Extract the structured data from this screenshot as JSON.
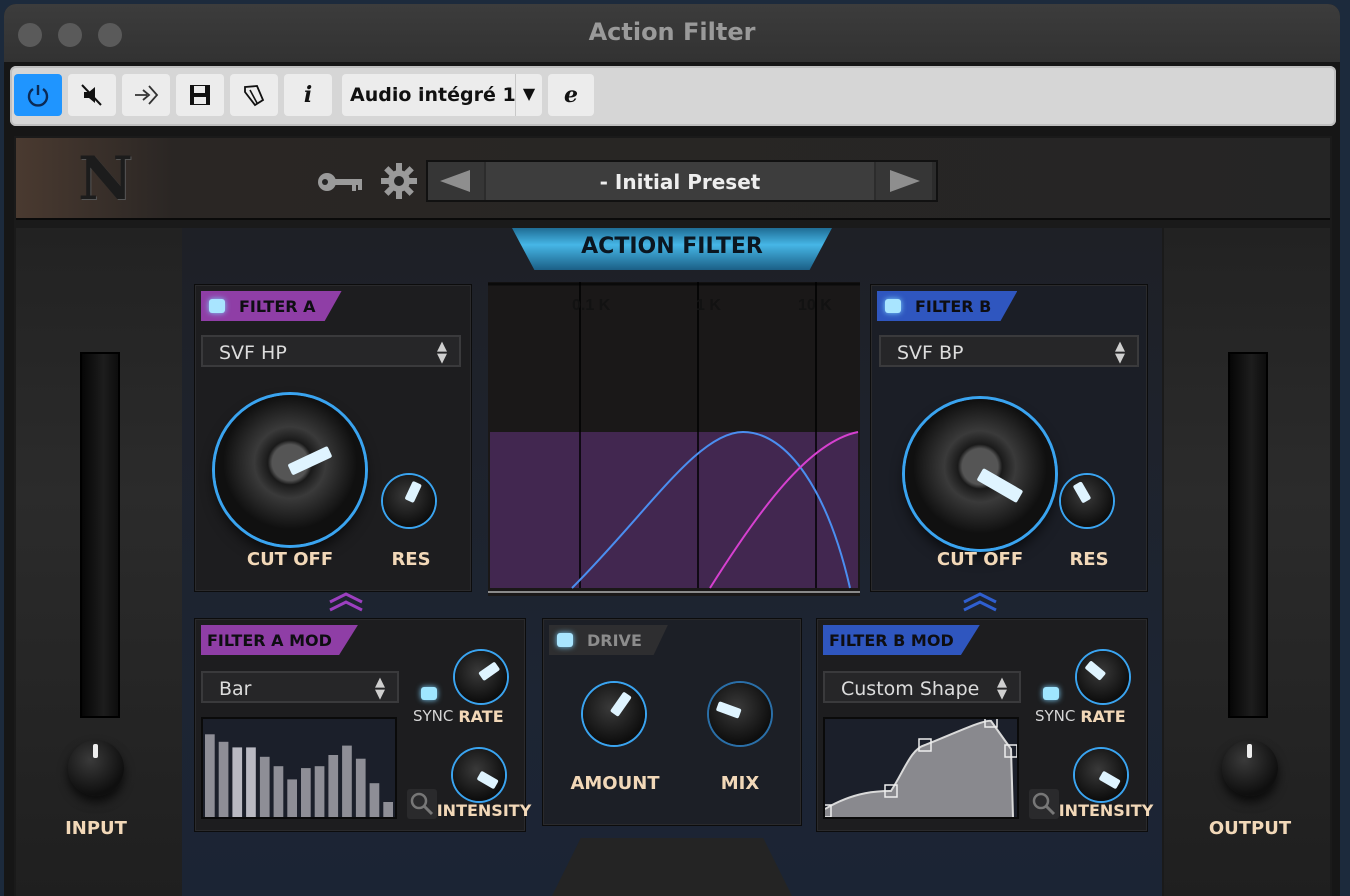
{
  "window": {
    "title": "Action Filter"
  },
  "toolbar": {
    "power_icon": "power-icon",
    "mute_icon": "speaker-mute-icon",
    "route_icon": "arrow-route-icon",
    "save_icon": "save-icon",
    "tag_icon": "tag-icon",
    "info_label": "i",
    "input_select": "Audio intégré 1",
    "dropdown_glyph": "▼",
    "edit_label": "e",
    "active_color": "#1f95ff"
  },
  "plugin": {
    "logo": "N",
    "preset_name": "- Initial Preset",
    "title": "ACTION FILTER",
    "input_label": "INPUT",
    "output_label": "OUTPUT",
    "filter_a": {
      "label": "FILTER A",
      "type": "SVF HP",
      "cutoff_label": "CUT OFF",
      "res_label": "RES",
      "color": "#8f3ea6"
    },
    "filter_b": {
      "label": "FILTER B",
      "type": "SVF BP",
      "cutoff_label": "CUT OFF",
      "res_label": "RES",
      "color": "#2f56bf"
    },
    "graph": {
      "freq_labels": [
        "0.1 K",
        "1 K",
        "10 K"
      ]
    },
    "filter_a_mod": {
      "label": "FILTER A MOD",
      "shape": "Bar",
      "sync_label": "SYNC",
      "rate_label": "RATE",
      "intensity_label": "INTENSITY",
      "bars": [
        0.88,
        0.8,
        0.74,
        0.74,
        0.64,
        0.54,
        0.4,
        0.52,
        0.54,
        0.66,
        0.76,
        0.62,
        0.36,
        0.16
      ]
    },
    "drive": {
      "label": "DRIVE",
      "amount_label": "AMOUNT",
      "mix_label": "MIX"
    },
    "filter_b_mod": {
      "label": "FILTER B MOD",
      "shape": "Custom Shape",
      "sync_label": "SYNC",
      "rate_label": "RATE",
      "intensity_label": "INTENSITY"
    }
  }
}
